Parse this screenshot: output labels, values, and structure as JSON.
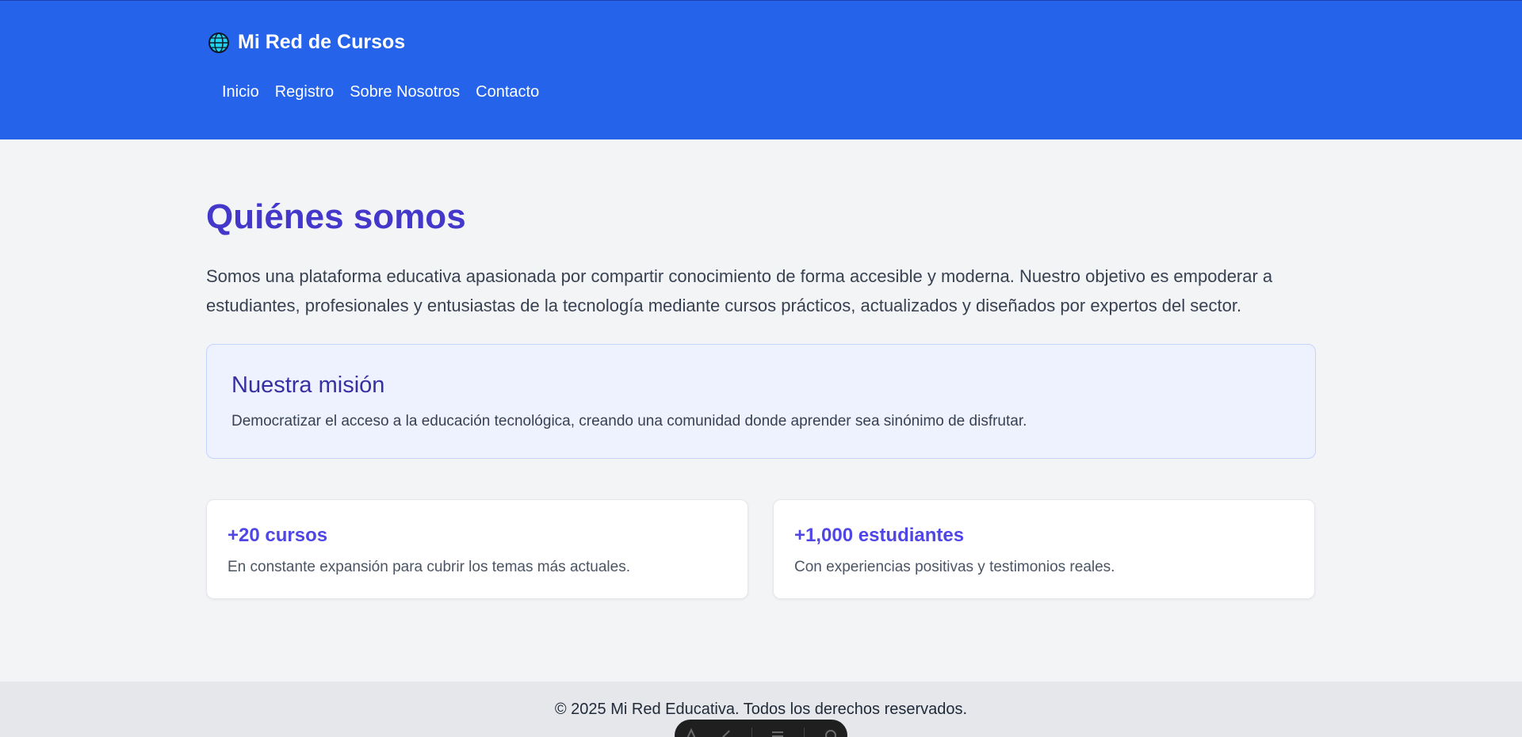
{
  "header": {
    "brand": "Mi Red de Cursos",
    "brand_icon": "globe-icon",
    "background": "#2563eb",
    "nav": [
      {
        "label": "Inicio"
      },
      {
        "label": "Registro"
      },
      {
        "label": "Sobre Nosotros"
      },
      {
        "label": "Contacto"
      }
    ]
  },
  "main": {
    "title": "Quiénes somos",
    "intro": "Somos una plataforma educativa apasionada por compartir conocimiento de forma accesible y moderna. Nuestro objetivo es empoderar a estudiantes, profesionales y entusiastas de la tecnología mediante cursos prácticos, actualizados y diseñados por expertos del sector.",
    "mission": {
      "heading": "Nuestra misión",
      "text": "Democratizar el acceso a la educación tecnológica, creando una comunidad donde aprender sea sinónimo de disfrutar."
    },
    "stats": [
      {
        "value": "+20 cursos",
        "text": "En constante expansión para cubrir los temas más actuales."
      },
      {
        "value": "+1,000 estudiantes",
        "text": "Con experiencias positivas y testimonios reales."
      }
    ]
  },
  "footer": {
    "text": "© 2025 Mi Red Educativa. Todos los derechos reservados."
  },
  "colors": {
    "accent": "#4338ca",
    "stat_accent": "#4f46e5",
    "mission_bg": "#eef2ff"
  },
  "toolbar": {
    "icons": [
      "pen-icon",
      "brush-icon",
      "menu-icon",
      "settings-icon"
    ]
  }
}
